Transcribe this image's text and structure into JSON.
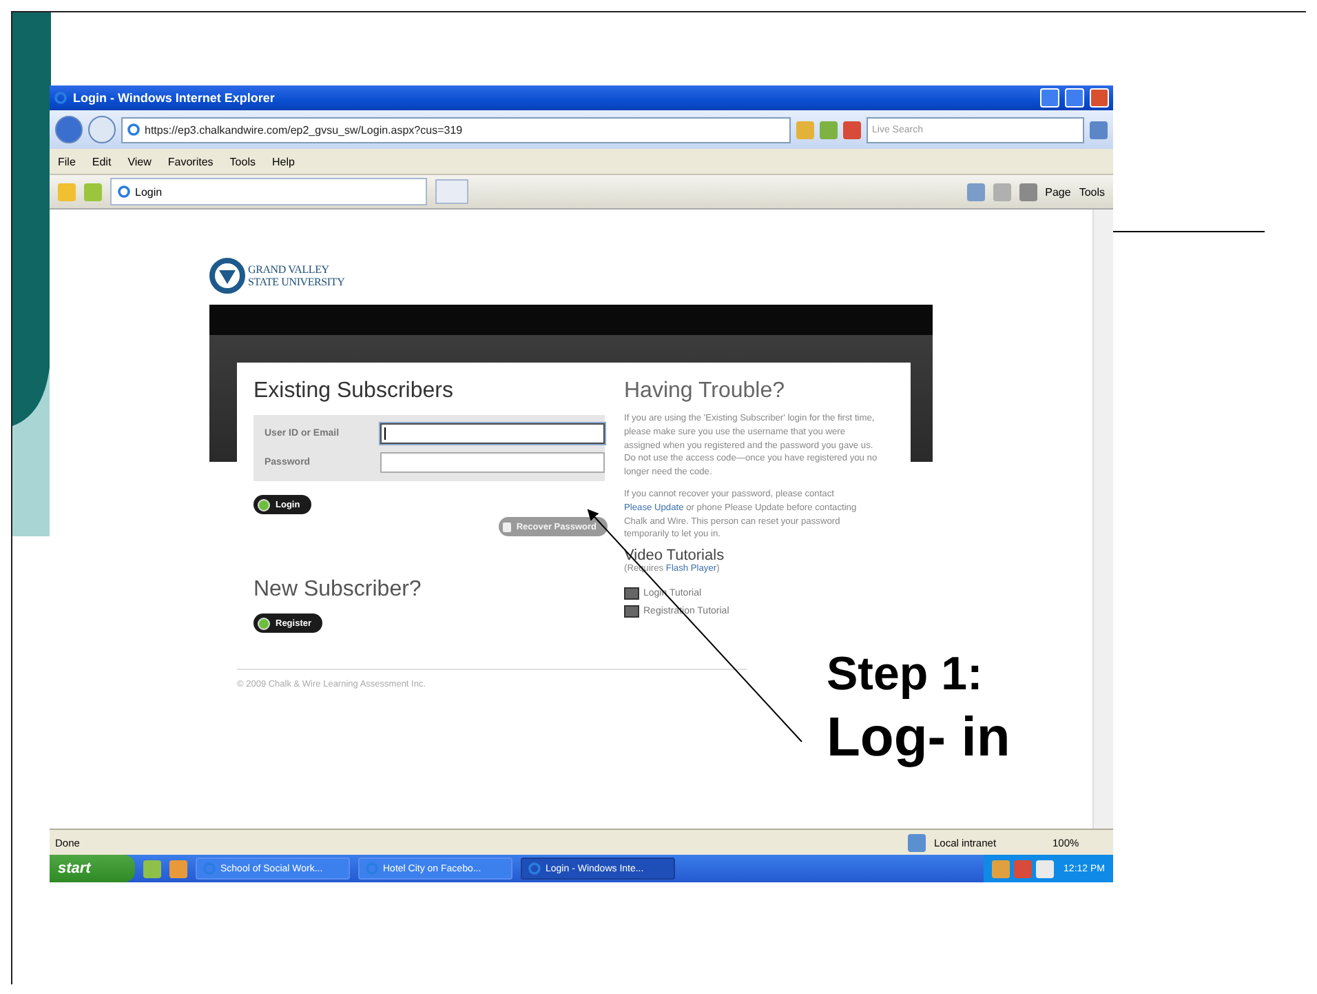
{
  "window": {
    "title": "Login - Windows Internet Explorer"
  },
  "address_bar": {
    "url": "https://ep3.chalkandwire.com/ep2_gvsu_sw/Login.aspx?cus=319",
    "search_placeholder": "Live Search"
  },
  "menu": [
    "File",
    "Edit",
    "View",
    "Favorites",
    "Tools",
    "Help"
  ],
  "tab": {
    "label": "Login"
  },
  "command_bar": [
    "Page",
    "Tools"
  ],
  "page": {
    "logo": {
      "line1": "GRAND VALLEY",
      "line2": "STATE UNIVERSITY"
    },
    "login": {
      "title": "Existing Subscribers",
      "fields": [
        {
          "label": "User ID or Email",
          "focused": true
        },
        {
          "label": "Password",
          "focused": false
        }
      ],
      "login_button": "Login",
      "recover_button": {
        "label": "Recover Password",
        "disabled": true
      },
      "new_title": "New Subscriber?",
      "register_button": "Register"
    },
    "help": {
      "title": "Having Trouble?",
      "paragraph_1": "If you are using the 'Existing Subscriber' login for the first time, please make sure you use the username that you were assigned when you registered and the password you gave us. Do not use the access code—once you have registered you no longer need the code.",
      "paragraph_2": {
        "before": "If you cannot recover your password, please contact ",
        "link": "Please Update",
        "after": " or phone Please Update before contacting Chalk and Wire. This person can reset your password temporarily to let you in."
      },
      "video_title": "Video Tutorials",
      "requires": {
        "before": "(Requires ",
        "link": "Flash Player",
        "after": ")"
      },
      "tutorials": [
        "Login Tutorial",
        "Registration Tutorial"
      ]
    },
    "footer": "© 2009 Chalk & Wire Learning Assessment Inc."
  },
  "status_bar": {
    "text": "Done",
    "zone": "Local intranet",
    "zoom": "100%"
  },
  "taskbar": {
    "start": "start",
    "tasks": [
      {
        "label": "School of Social Work...",
        "selected": false
      },
      {
        "label": "Hotel City on Facebo...",
        "selected": false
      },
      {
        "label": "Login - Windows Inte...",
        "selected": true
      }
    ],
    "clock": "12:12 PM"
  },
  "slide": {
    "caption": [
      "Step 1:",
      "Log- in"
    ]
  }
}
